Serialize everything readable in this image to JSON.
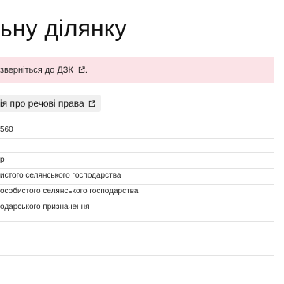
{
  "title": "ьну ділянку",
  "alert": {
    "text": "зверніться до",
    "link_label": "ДЗК",
    "suffix": "."
  },
  "rights_button": {
    "label": "ія про речові права"
  },
  "details": {
    "rows": [
      "560",
      "",
      "р",
      "истого селянського господарства",
      "особистого селянського господарства",
      "одарського призначення",
      ""
    ]
  },
  "colors": {
    "alert_background": "#fbe3e7",
    "chip_background": "#f0f0f0"
  }
}
